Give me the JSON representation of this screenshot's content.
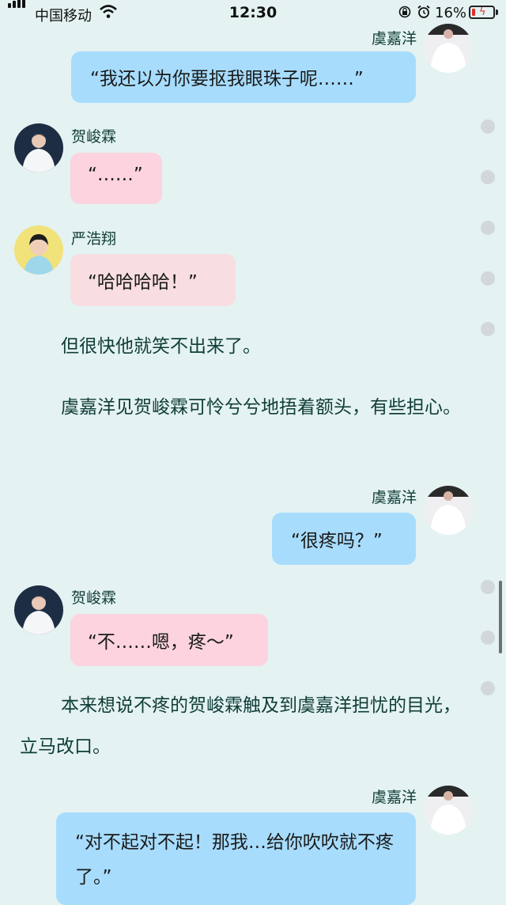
{
  "status_bar": {
    "carrier": "中国移动",
    "time": "12:30",
    "battery_percent_label": "16%",
    "battery_level": 0.16,
    "icons": [
      "signal-icon",
      "wifi-icon",
      "orientation-lock-icon",
      "alarm-icon",
      "battery-icon"
    ]
  },
  "colors": {
    "background": "#e4f2f2",
    "bubble_blue": "#a7dcfd",
    "bubble_pink": "#fcd3de",
    "bubble_skin": "#f8dee0",
    "name_text": "#0f3d36"
  },
  "messages": [
    {
      "sender": "虞嘉洋",
      "text": "“我还以为你要抠我眼珠子呢……”"
    },
    {
      "sender": "贺峻霖",
      "text": "“……”"
    },
    {
      "sender": "严浩翔",
      "text": "“哈哈哈哈！”"
    },
    {
      "narration": "但很快他就笑不出来了。"
    },
    {
      "narration": "虞嘉洋见贺峻霖可怜兮兮地捂着额头，有些担心。"
    },
    {
      "sender": "虞嘉洋",
      "text": "“很疼吗？”"
    },
    {
      "sender": "贺峻霖",
      "text": "“不……嗯，疼～”"
    },
    {
      "narration": "本来想说不疼的贺峻霖触及到虞嘉洋担忧的目光，立马改口。"
    },
    {
      "sender": "虞嘉洋",
      "text": "“对不起对不起！那我…给你吹吹就不疼了。”"
    }
  ]
}
